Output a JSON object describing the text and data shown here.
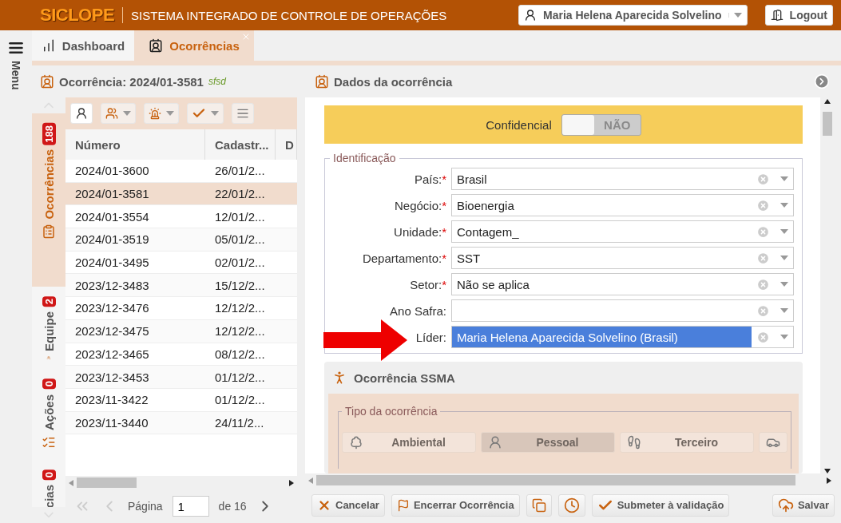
{
  "header": {
    "logo": "SICLOPE",
    "subtitle": "SISTEMA INTEGRADO DE CONTROLE DE OPERAÇÕES",
    "user": "Maria Helena Aparecida Solvelino",
    "logout": "Logout"
  },
  "menu": {
    "label": "Menu"
  },
  "tabs": [
    {
      "label": "Dashboard",
      "selected": false,
      "kind": "chart"
    },
    {
      "label": "Ocorrências",
      "selected": true,
      "kind": "person"
    }
  ],
  "left_panel": {
    "title": "Ocorrência: 2024/01-3581",
    "tag": "sfsd",
    "side_tabs": [
      {
        "label": "Ocorrências",
        "count": "188",
        "selected": true,
        "kind": "report"
      },
      {
        "label": "Equipe",
        "count": "2",
        "selected": false,
        "kind": "team"
      },
      {
        "label": "Ações",
        "count": "0",
        "selected": false,
        "kind": "actions"
      },
      {
        "label": "cias",
        "count": "0",
        "selected": false,
        "kind": "plain"
      }
    ],
    "columns": [
      "Número",
      "Cadastr...",
      "D"
    ],
    "rows": [
      {
        "numero": "2024/01-3600",
        "cadastro": "26/01/2...",
        "selected": false
      },
      {
        "numero": "2024/01-3581",
        "cadastro": "22/01/2...",
        "selected": true
      },
      {
        "numero": "2024/01-3554",
        "cadastro": "12/01/2...",
        "selected": false
      },
      {
        "numero": "2024/01-3519",
        "cadastro": "05/01/2...",
        "selected": false
      },
      {
        "numero": "2024/01-3495",
        "cadastro": "02/01/2...",
        "selected": false
      },
      {
        "numero": "2023/12-3483",
        "cadastro": "15/12/2...",
        "selected": false
      },
      {
        "numero": "2023/12-3476",
        "cadastro": "12/12/2...",
        "selected": false
      },
      {
        "numero": "2023/12-3475",
        "cadastro": "12/12/2...",
        "selected": false
      },
      {
        "numero": "2023/12-3465",
        "cadastro": "08/12/2...",
        "selected": false
      },
      {
        "numero": "2023/12-3453",
        "cadastro": "01/12/2...",
        "selected": false
      },
      {
        "numero": "2023/11-3422",
        "cadastro": "01/12/2...",
        "selected": false
      },
      {
        "numero": "2023/11-3440",
        "cadastro": "24/11/2...",
        "selected": false
      }
    ],
    "pager": {
      "label": "Página",
      "page": "1",
      "total": "de 16"
    }
  },
  "right_panel": {
    "title": "Dados da ocorrência",
    "confidential": {
      "label": "Confidencial",
      "on": false,
      "state_text": "NÃO"
    },
    "identificacao": {
      "legend": "Identificação",
      "fields": [
        {
          "label": "País:",
          "required_mark": "*",
          "value": "Brasil",
          "highlighted": false
        },
        {
          "label": "Negócio:",
          "required_mark": "*",
          "value": "Bioenergia",
          "highlighted": false
        },
        {
          "label": "Unidade:",
          "required_mark": "*",
          "value": "Contagem_",
          "highlighted": false
        },
        {
          "label": "Departamento:",
          "required_mark": "*",
          "value": "SST",
          "highlighted": false
        },
        {
          "label": "Setor:",
          "required_mark": "*",
          "value": "Não se aplica",
          "highlighted": false
        },
        {
          "label": "Ano Safra:",
          "highlighted": false
        },
        {
          "label": "Líder:",
          "value": "Maria Helena Aparecida Solvelino (Brasil)",
          "highlighted": true
        }
      ]
    },
    "ssma": {
      "title": "Ocorrência SSMA",
      "legend": "Tipo da ocorrência",
      "types": [
        {
          "label": "Ambiental",
          "selected": false,
          "kind": "tree"
        },
        {
          "label": "Pessoal",
          "selected": true,
          "kind": "person"
        },
        {
          "label": "Terceiro",
          "selected": false,
          "kind": "footprints"
        },
        {
          "selected": false,
          "kind": "vehicle"
        }
      ]
    }
  },
  "footer": [
    {
      "kind": "cancel",
      "label": "Cancelar"
    },
    {
      "kind": "close",
      "label": "Encerrar Ocorrência"
    },
    {
      "kind": "copy"
    },
    {
      "kind": "history"
    },
    {
      "kind": "submit",
      "label": "Submeter à validação"
    },
    {
      "kind": "save",
      "label": "Salvar"
    }
  ]
}
